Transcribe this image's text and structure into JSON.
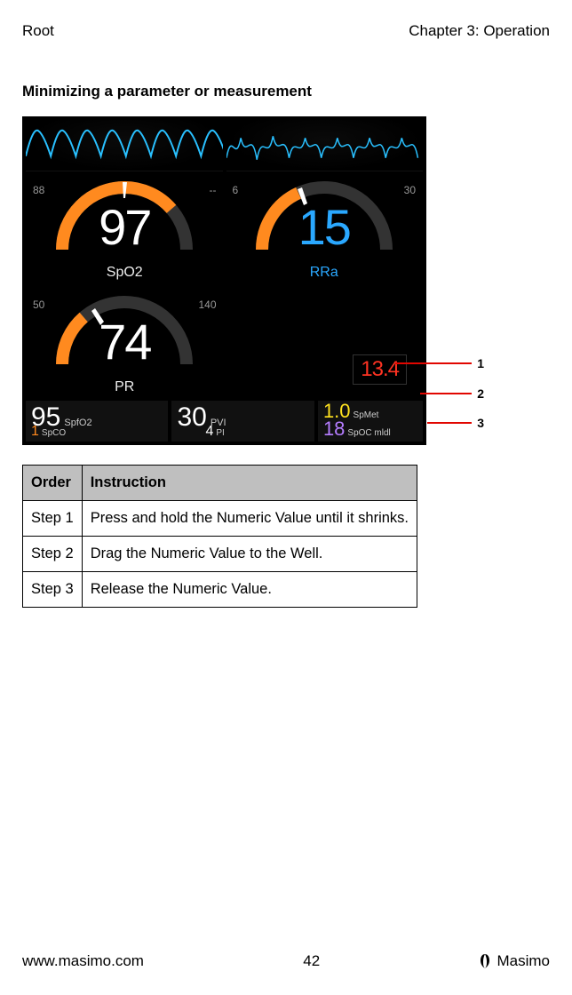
{
  "header": {
    "left": "Root",
    "right": "Chapter 3: Operation"
  },
  "section_title": "Minimizing a parameter or measurement",
  "gauges": {
    "spo2": {
      "low": "88",
      "high": "--",
      "value": "97",
      "label": "SpO2"
    },
    "rra": {
      "low": "6",
      "high": "30",
      "value": "15",
      "label": "RRa"
    },
    "pr": {
      "low": "50",
      "high": "140",
      "value": "74",
      "label": "PR"
    },
    "drag_chip_value": "13.4"
  },
  "well": {
    "spfo2": {
      "value": "95",
      "label": "SpfO2"
    },
    "spco": {
      "value": "1",
      "label": "SpCO"
    },
    "pvi": {
      "value": "30",
      "label": "PVI"
    },
    "pi": {
      "value": "4",
      "label": "PI"
    },
    "spmet": {
      "value": "1.0",
      "label": "SpMet"
    },
    "spoc": {
      "value": "18",
      "label": "SpOC mldl"
    }
  },
  "callouts": {
    "one": "1",
    "two": "2",
    "three": "3"
  },
  "table": {
    "head_order": "Order",
    "head_instruction": "Instruction",
    "rows": [
      {
        "order": "Step 1",
        "instruction": "Press and hold the Numeric Value until it shrinks."
      },
      {
        "order": "Step 2",
        "instruction": "Drag the Numeric Value to the Well."
      },
      {
        "order": "Step 3",
        "instruction": "Release the Numeric Value."
      }
    ]
  },
  "footer": {
    "url": "www.masimo.com",
    "page": "42",
    "brand": "Masimo"
  }
}
